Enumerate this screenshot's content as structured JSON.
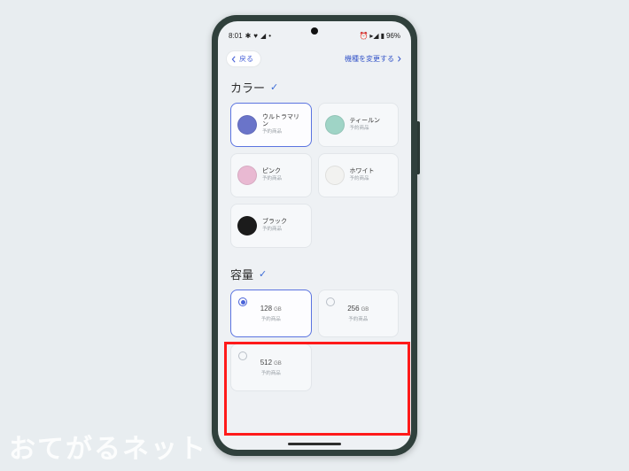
{
  "statusbar": {
    "time": "8:01",
    "battery": "96%"
  },
  "topbar": {
    "back": "戻る",
    "change": "機種を変更する"
  },
  "color": {
    "title": "カラー",
    "items": [
      {
        "name": "ウルトラマリン",
        "sub": "予約商品",
        "swatch": "#6a74c9",
        "selected": true
      },
      {
        "name": "ティールン",
        "sub": "予約商品",
        "swatch": "#9fd4c6",
        "selected": false
      },
      {
        "name": "ピンク",
        "sub": "予約商品",
        "swatch": "#e9b9d2",
        "selected": false
      },
      {
        "name": "ホワイト",
        "sub": "予約商品",
        "swatch": "#f2f2f0",
        "selected": false
      },
      {
        "name": "ブラック",
        "sub": "予約商品",
        "swatch": "#1b1b1b",
        "selected": false
      }
    ]
  },
  "storage": {
    "title": "容量",
    "items": [
      {
        "size": "128",
        "unit": "GB",
        "sub": "予約商品",
        "selected": true
      },
      {
        "size": "256",
        "unit": "GB",
        "sub": "予約商品",
        "selected": false
      },
      {
        "size": "512",
        "unit": "GB",
        "sub": "予約商品",
        "selected": false
      }
    ]
  },
  "watermark": "おてがるネット"
}
